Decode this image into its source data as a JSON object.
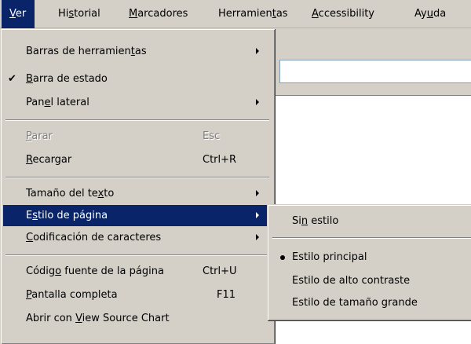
{
  "menubar": {
    "ver": {
      "u": "V",
      "post": "er"
    },
    "historial": {
      "pre": "Hi",
      "u": "s",
      "post": "torial"
    },
    "marcadores": {
      "u": "M",
      "post": "arcadores"
    },
    "herramientas": {
      "pre": "Herramien",
      "u": "t",
      "post": "as"
    },
    "accessibility": {
      "u": "A",
      "post": "ccessibility"
    },
    "ayuda": {
      "pre": "Ay",
      "u": "u",
      "post": "da"
    }
  },
  "ver_menu": {
    "barras": {
      "pre": "Barras de herramien",
      "u": "t",
      "post": "as"
    },
    "barra_estado": {
      "u": "B",
      "post": "arra de estado",
      "check": "✔"
    },
    "panel_lateral": {
      "pre": "Pan",
      "u": "e",
      "post": "l lateral"
    },
    "parar": {
      "u": "P",
      "post": "arar",
      "shortcut": "Esc"
    },
    "recargar": {
      "u": "R",
      "post": "ecargar",
      "shortcut": "Ctrl+R"
    },
    "tamano": {
      "pre": "Tamaño del te",
      "u": "x",
      "post": "to"
    },
    "estilo": {
      "pre": "E",
      "u": "s",
      "post": "tilo de página"
    },
    "codificacion": {
      "u": "C",
      "post": "odificación de caracteres"
    },
    "codigo_fuente": {
      "pre": "Códig",
      "u": "o",
      "post": " fuente de la página",
      "shortcut": "Ctrl+U"
    },
    "pantalla": {
      "u": "P",
      "post": "antalla completa",
      "shortcut": "F11"
    },
    "abrir": {
      "pre": "Abrir con ",
      "u": "V",
      "post": "iew Source Chart"
    }
  },
  "estilo_menu": {
    "sin_estilo": {
      "pre": "Si",
      "u": "n",
      "post": " estilo"
    },
    "principal": "Estilo principal",
    "alto_contraste": "Estilo de alto contraste",
    "tamano_grande": "Estilo de tamaño grande"
  },
  "colors": {
    "menu_bg": "#d4d0c8",
    "highlight": "#0a246a",
    "disabled": "#808080"
  }
}
